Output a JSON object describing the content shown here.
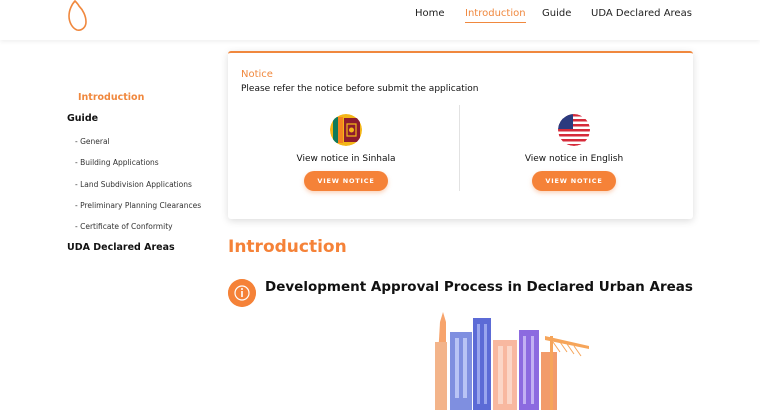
{
  "header": {
    "nav": [
      {
        "label": "Home",
        "active": false
      },
      {
        "label": "Introduction",
        "active": true
      },
      {
        "label": "Guide",
        "active": false
      },
      {
        "label": "UDA Declared Areas",
        "active": false
      }
    ]
  },
  "sidebar": {
    "introduction": "Introduction",
    "guide": "Guide",
    "guide_items": [
      "- General",
      "- Building Applications",
      "- Land Subdivision Applications",
      "- Preliminary Planning Clearances",
      "- Certificate of Conformity"
    ],
    "uda": "UDA Declared Areas"
  },
  "notice": {
    "title": "Notice",
    "subtitle": "Please refer the notice before submit the application",
    "sinhala_label": "View notice in Sinhala",
    "english_label": "View notice in English",
    "button_label": "VIEW NOTICE",
    "sinhala_flag_icon": "sri-lanka-flag-icon",
    "english_flag_icon": "usa-flag-icon"
  },
  "main": {
    "heading": "Introduction",
    "section_title": "Development Approval Process in Declared Urban Areas",
    "section_icon": "info-icon"
  },
  "colors": {
    "accent": "#f58238",
    "text": "#111111"
  }
}
